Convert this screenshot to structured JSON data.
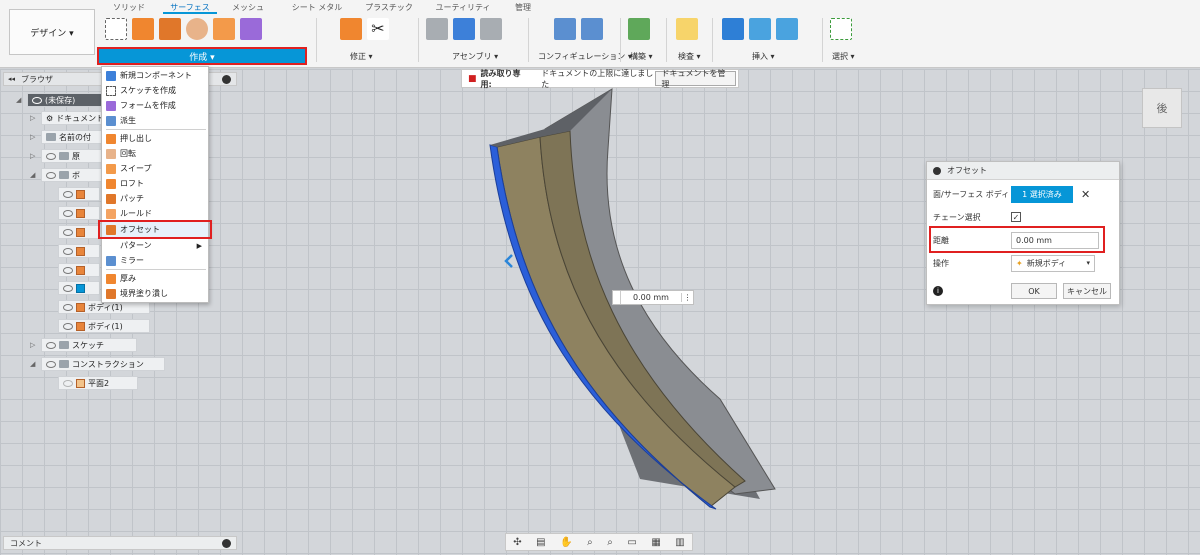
{
  "toolbar": {
    "design_label": "デザイン ▾",
    "tabs": [
      "ソリッド",
      "サーフェス",
      "メッシュ",
      "シート メタル",
      "プラスチック",
      "ユーティリティ",
      "管理"
    ],
    "create_label": "作成 ▾",
    "groups": {
      "modify": "修正 ▾",
      "assembly": "アセンブリ ▾",
      "configuration": "コンフィギュレーション ▾",
      "construct": "構築 ▾",
      "inspect": "検査 ▾",
      "insert": "挿入 ▾",
      "select": "選択 ▾"
    }
  },
  "browser": {
    "title": "ブラウザ",
    "root": "(未保存)",
    "rows": [
      "ドキュメント",
      "名前の付",
      "原",
      "ボ",
      "",
      "",
      "",
      "",
      "",
      "ボディ(1)",
      "ボディ(1)",
      "スケッチ",
      "コンストラクション",
      "平面2"
    ]
  },
  "create_menu": {
    "items": [
      "新規コンポーネント",
      "スケッチを作成",
      "フォームを作成",
      "派生",
      "押し出し",
      "回転",
      "スイープ",
      "ロフト",
      "パッチ",
      "ルールド",
      "オフセット",
      "パターン",
      "ミラー",
      "厚み",
      "境界塗り潰し"
    ]
  },
  "readonly_banner": {
    "label": "読み取り専用:",
    "message": "ドキュメントの上限に達しました",
    "button": "ドキュメントを管理"
  },
  "offset_dialog": {
    "title": "オフセット",
    "face_label": "面/サーフェス ボディ",
    "face_value": "1 選択済み",
    "chain_label": "チェーン選択",
    "distance_label": "距離",
    "distance_value": "0.00 mm",
    "operation_label": "操作",
    "operation_value": "新規ボディ",
    "ok": "OK",
    "cancel": "キャンセル"
  },
  "canvas": {
    "dim_value": "0.00 mm",
    "viewcube_label": "後"
  },
  "comment_panel": "コメント",
  "colors": {
    "accent": "#0696d7",
    "highlight": "#e02020",
    "surface_tan": "#8f8361",
    "edge_blue": "#2b5fd9"
  }
}
